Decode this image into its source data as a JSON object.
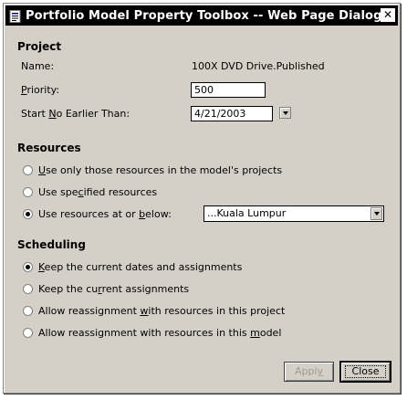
{
  "window": {
    "title": "Portfolio Model Property Toolbox -- Web Page Dialog",
    "close_glyph": "✕"
  },
  "project": {
    "heading": "Project",
    "name_label": "Name:",
    "name_value": "100X DVD Drive.Published",
    "priority_label_pre": "",
    "priority_label_key": "P",
    "priority_label_post": "riority:",
    "priority_value": "500",
    "start_label_pre": "Start ",
    "start_label_key": "N",
    "start_label_post": "o Earlier Than:",
    "start_value": "4/21/2003"
  },
  "resources": {
    "heading": "Resources",
    "options": [
      {
        "pre": "",
        "key": "U",
        "post": "se only those resources in the model's projects",
        "selected": false
      },
      {
        "pre": "Use spe",
        "key": "c",
        "post": "ified resources",
        "selected": false
      },
      {
        "pre": "Use resources at or ",
        "key": "b",
        "post": "elow:",
        "selected": true
      }
    ],
    "location_value": "...Kuala Lumpur"
  },
  "scheduling": {
    "heading": "Scheduling",
    "options": [
      {
        "pre": "",
        "key": "K",
        "post": "eep the current dates and assignments",
        "selected": true
      },
      {
        "pre": "Keep the cu",
        "key": "r",
        "post": "rent assignments",
        "selected": false
      },
      {
        "pre": "Allow reassignment ",
        "key": "w",
        "post": "ith resources in this project",
        "selected": false
      },
      {
        "pre": "Allow reassignment with resources in this ",
        "key": "m",
        "post": "odel",
        "selected": false
      }
    ]
  },
  "buttons": {
    "apply_pre": "Appl",
    "apply_key": "y",
    "apply_post": "",
    "close_label": "Close"
  },
  "colors": {
    "dialog_bg": "#d4d0c8",
    "title_bar": "#000000"
  },
  "icons": {
    "title": "dialog-page-icon",
    "close": "close-icon",
    "date_dropdown": "chevron-down-icon",
    "location_dropdown": "chevron-down-icon"
  }
}
